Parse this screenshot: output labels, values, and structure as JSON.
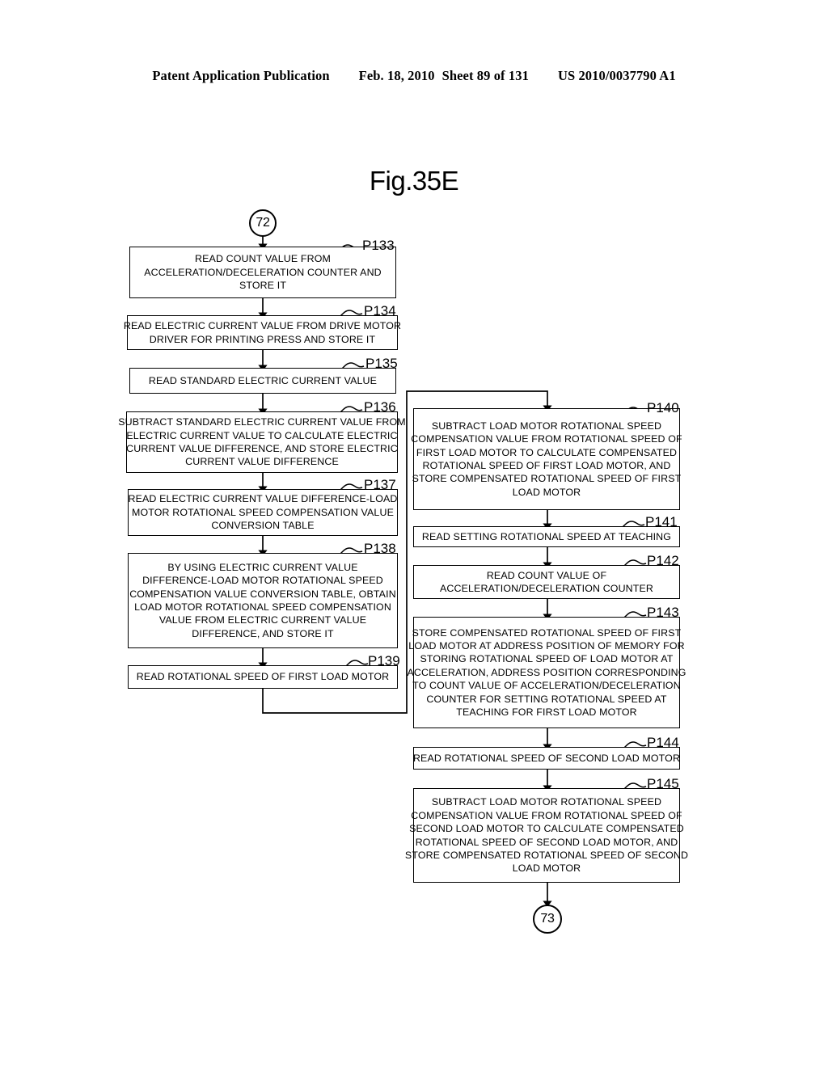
{
  "header": {
    "publication": "Patent Application Publication",
    "date": "Feb. 18, 2010",
    "sheet": "Sheet 89 of 131",
    "patent_number": "US 2010/0037790 A1"
  },
  "figure": {
    "title": "Fig.35E"
  },
  "connectors": {
    "entry": "72",
    "exit": "73"
  },
  "flow": {
    "left_column": [
      {
        "id": "P133",
        "label": "P133",
        "lines": [
          "READ COUNT VALUE FROM",
          "ACCELERATION/DECELERATION COUNTER AND",
          "STORE IT"
        ]
      },
      {
        "id": "P134",
        "label": "P134",
        "lines": [
          "READ ELECTRIC CURRENT VALUE FROM DRIVE MOTOR",
          "DRIVER FOR PRINTING PRESS AND STORE IT"
        ]
      },
      {
        "id": "P135",
        "label": "P135",
        "lines": [
          "READ STANDARD ELECTRIC CURRENT VALUE"
        ]
      },
      {
        "id": "P136",
        "label": "P136",
        "lines": [
          "SUBTRACT STANDARD ELECTRIC CURRENT VALUE FROM",
          "ELECTRIC CURRENT VALUE TO CALCULATE ELECTRIC",
          "CURRENT VALUE DIFFERENCE, AND STORE ELECTRIC",
          "CURRENT VALUE DIFFERENCE"
        ]
      },
      {
        "id": "P137",
        "label": "P137",
        "lines": [
          "READ ELECTRIC CURRENT VALUE DIFFERENCE-LOAD",
          "MOTOR ROTATIONAL SPEED COMPENSATION VALUE",
          "CONVERSION TABLE"
        ]
      },
      {
        "id": "P138",
        "label": "P138",
        "lines": [
          "BY USING ELECTRIC CURRENT VALUE",
          "DIFFERENCE-LOAD MOTOR ROTATIONAL SPEED",
          "COMPENSATION VALUE CONVERSION TABLE, OBTAIN",
          "LOAD MOTOR ROTATIONAL SPEED COMPENSATION",
          "VALUE FROM ELECTRIC CURRENT VALUE",
          "DIFFERENCE, AND STORE IT"
        ]
      },
      {
        "id": "P139",
        "label": "P139",
        "lines": [
          "READ ROTATIONAL SPEED OF FIRST LOAD MOTOR"
        ]
      }
    ],
    "right_column": [
      {
        "id": "P140",
        "label": "P140",
        "lines": [
          "SUBTRACT LOAD MOTOR ROTATIONAL SPEED",
          "COMPENSATION VALUE FROM ROTATIONAL SPEED OF",
          "FIRST LOAD MOTOR TO CALCULATE COMPENSATED",
          "ROTATIONAL SPEED OF FIRST LOAD MOTOR, AND",
          "STORE COMPENSATED ROTATIONAL SPEED OF FIRST",
          "LOAD MOTOR"
        ]
      },
      {
        "id": "P141",
        "label": "P141",
        "lines": [
          "READ SETTING ROTATIONAL SPEED AT TEACHING"
        ]
      },
      {
        "id": "P142",
        "label": "P142",
        "lines": [
          "READ COUNT VALUE OF",
          "ACCELERATION/DECELERATION COUNTER"
        ]
      },
      {
        "id": "P143",
        "label": "P143",
        "lines": [
          "STORE COMPENSATED ROTATIONAL SPEED OF FIRST",
          "LOAD MOTOR AT ADDRESS POSITION OF MEMORY FOR",
          "STORING ROTATIONAL SPEED OF LOAD MOTOR AT",
          "ACCELERATION, ADDRESS POSITION CORRESPONDING",
          "TO COUNT VALUE OF ACCELERATION/DECELERATION",
          "COUNTER FOR SETTING ROTATIONAL SPEED AT",
          "TEACHING FOR FIRST LOAD MOTOR"
        ]
      },
      {
        "id": "P144",
        "label": "P144",
        "lines": [
          "READ ROTATIONAL SPEED OF SECOND LOAD MOTOR"
        ]
      },
      {
        "id": "P145",
        "label": "P145",
        "lines": [
          "SUBTRACT LOAD MOTOR ROTATIONAL SPEED",
          "COMPENSATION VALUE FROM ROTATIONAL SPEED OF",
          "SECOND LOAD MOTOR TO CALCULATE COMPENSATED",
          "ROTATIONAL SPEED OF SECOND LOAD MOTOR, AND",
          "STORE COMPENSATED ROTATIONAL SPEED OF SECOND",
          "LOAD MOTOR"
        ]
      }
    ]
  }
}
